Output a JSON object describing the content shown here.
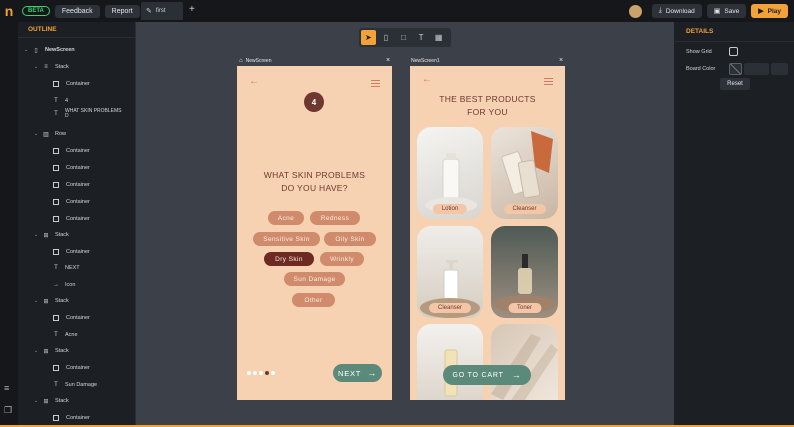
{
  "topbar": {
    "logo": "n",
    "beta": "BETA",
    "feedback": "Feedback",
    "report": "Report",
    "tab_label": "first",
    "add_tab": "+",
    "download": "Download",
    "save": "Save",
    "play": "Play"
  },
  "outline": {
    "title": "OUTLINE",
    "items": [
      {
        "label": "NewScreen",
        "icon": "▯",
        "chev": "⌄"
      },
      {
        "label": "Stack",
        "icon": "≡",
        "chev": "⌄"
      },
      {
        "label": "Container",
        "icon": "box"
      },
      {
        "label": "4",
        "icon": "T"
      },
      {
        "label": "WHAT SKIN PROBLEMS D",
        "icon": "T"
      },
      {
        "label": "Row",
        "icon": "▥",
        "chev": "⌄"
      },
      {
        "label": "Container",
        "icon": "box"
      },
      {
        "label": "Container",
        "icon": "box"
      },
      {
        "label": "Container",
        "icon": "box"
      },
      {
        "label": "Container",
        "icon": "box"
      },
      {
        "label": "Container",
        "icon": "box"
      },
      {
        "label": "Stack",
        "icon": "⊞",
        "chev": "⌄"
      },
      {
        "label": "Container",
        "icon": "box"
      },
      {
        "label": "NEXT",
        "icon": "T"
      },
      {
        "label": "Icon",
        "icon": "→"
      },
      {
        "label": "Stack",
        "icon": "⊞",
        "chev": "⌄"
      },
      {
        "label": "Container",
        "icon": "box"
      },
      {
        "label": "Acne",
        "icon": "T"
      },
      {
        "label": "Stack",
        "icon": "⊞",
        "chev": "⌄"
      },
      {
        "label": "Container",
        "icon": "box"
      },
      {
        "label": "Sun Damage",
        "icon": "T"
      },
      {
        "label": "Stack",
        "icon": "⊞",
        "chev": "⌄"
      },
      {
        "label": "Container",
        "icon": "box"
      }
    ]
  },
  "screen1": {
    "label": "NewScreen",
    "close": "×",
    "step": "4",
    "question_line1": "WHAT SKIN PROBLEMS",
    "question_line2": "DO YOU HAVE?",
    "chips": [
      "Acne",
      "Redness",
      "Sensitive Skin",
      "Oily Skin",
      "Dry Skin",
      "Wrinkly",
      "Sun Damage",
      "Other"
    ],
    "selected_chip": "Dry Skin",
    "next": "NEXT"
  },
  "screen2": {
    "label": "NewScreen1",
    "close": "×",
    "title_line1": "THE BEST PRODUCTS",
    "title_line2": "FOR YOU",
    "products": [
      "Lotion",
      "Cleanser",
      "Cleanser",
      "Toner"
    ],
    "cart": "GO TO CART"
  },
  "details": {
    "title": "DETAILS",
    "show_grid": "Show Grid",
    "board_color": "Board Color",
    "reset": "Reset"
  },
  "colors": {
    "accent": "#f2a238",
    "beta": "#3ecf6f",
    "phone_bg": "#f7d2b2",
    "chip": "#cf8b6b",
    "chip_selected": "#6e2a22",
    "button_green": "#5b8a7b"
  }
}
